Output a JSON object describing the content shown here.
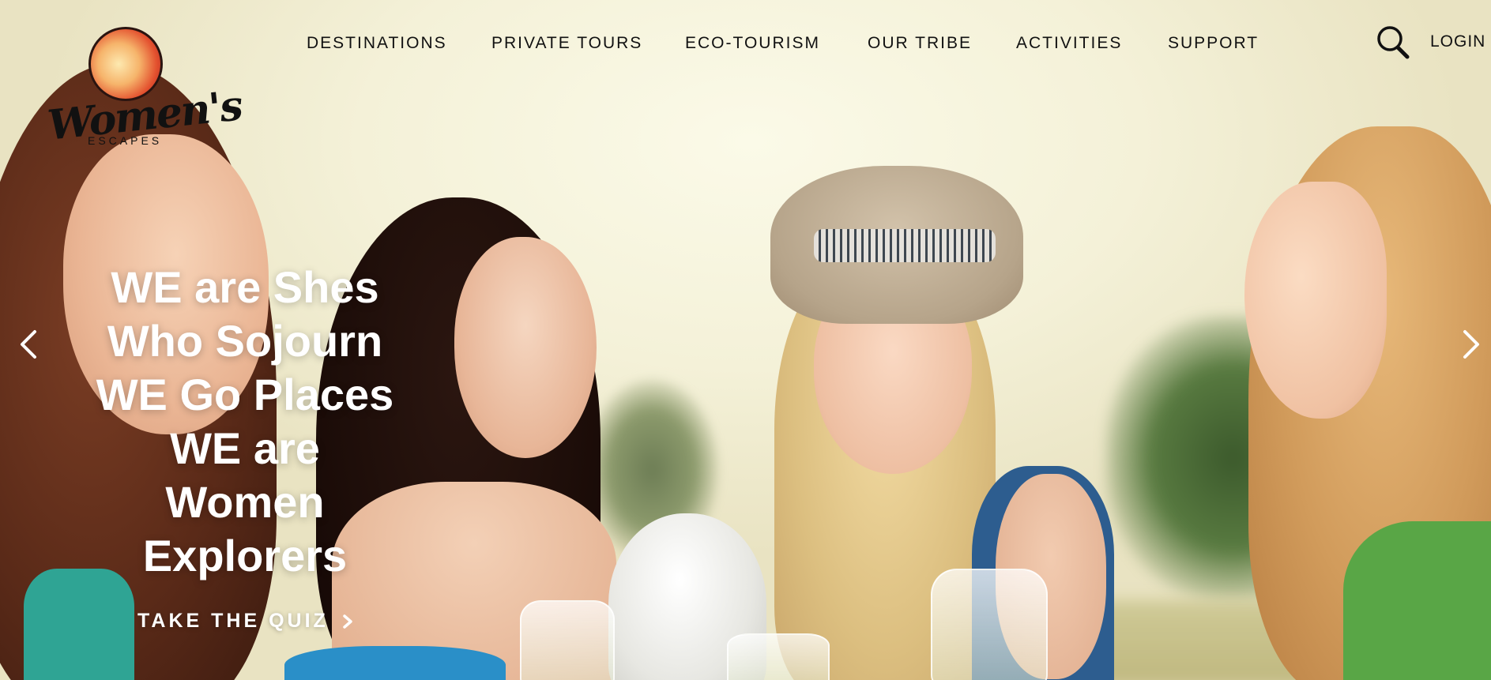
{
  "brand": {
    "logo_script": "Women's",
    "logo_sub": "ESCAPES"
  },
  "nav": {
    "items": [
      {
        "label": "DESTINATIONS"
      },
      {
        "label": "PRIVATE TOURS"
      },
      {
        "label": "ECO-TOURISM"
      },
      {
        "label": "OUR TRIBE"
      },
      {
        "label": "ACTIVITIES"
      },
      {
        "label": "SUPPORT"
      }
    ],
    "search_icon": "search-icon",
    "login_label": "LOGIN"
  },
  "hero": {
    "title_lines": [
      "WE are Shes",
      "Who Sojourn",
      "WE Go Places",
      "WE are",
      "Women",
      "Explorers"
    ],
    "cta_label": "TAKE THE QUIZ",
    "cta_icon": "chevron-right-icon",
    "prev_icon": "chevron-left-icon",
    "next_icon": "chevron-right-icon"
  },
  "colors": {
    "nav_text": "#111111",
    "hero_text": "#ffffff",
    "background": "#f3f0dc"
  }
}
